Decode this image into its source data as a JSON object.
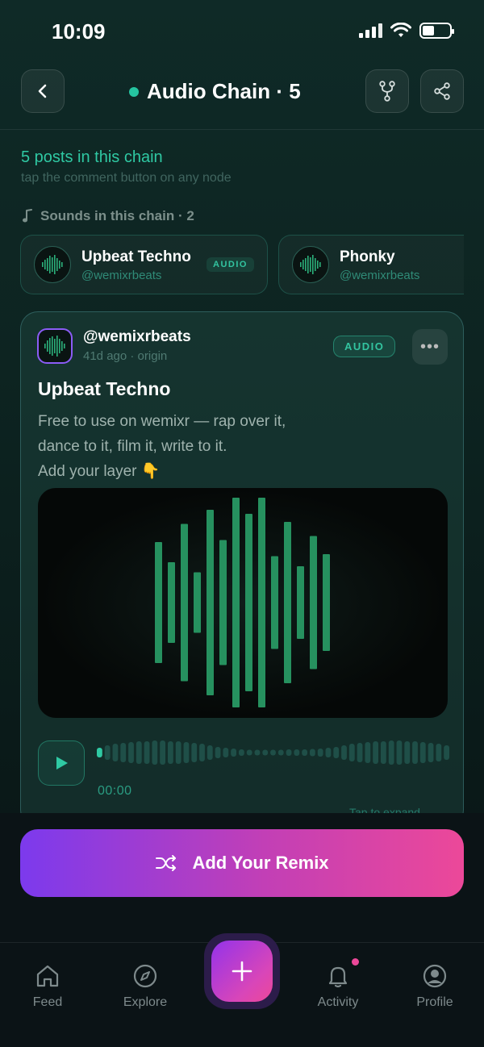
{
  "status_bar": {
    "time": "10:09"
  },
  "header": {
    "title": "Audio Chain · 5",
    "accent": "#25c4a0"
  },
  "chain": {
    "count_text": "5 posts in this chain",
    "hint": "tap the comment button on any node"
  },
  "sounds": {
    "label": "Sounds in this chain · 2",
    "items": [
      {
        "name": "Upbeat Techno",
        "handle": "@wemixrbeats",
        "badge": "AUDIO"
      },
      {
        "name": "Phonky",
        "handle": "@wemixrbeats",
        "badge": ""
      }
    ]
  },
  "post": {
    "user": "@wemixrbeats",
    "meta": "41d ago · origin",
    "badge": "AUDIO",
    "title": "Upbeat Techno",
    "body": "Free to use on wemixr — rap over it,\ndance to it, film it, write to it.\nAdd your layer 👇",
    "player": {
      "time": "00:00",
      "expand": "Tap to expand ⌄"
    }
  },
  "remix_button": {
    "label": "Add Your Remix"
  },
  "nav": {
    "feed": "Feed",
    "explore": "Explore",
    "activity": "Activity",
    "profile": "Profile"
  },
  "colors": {
    "brand_purple": "#7c3aed",
    "brand_pink": "#ec4899",
    "accent_teal": "#2fc9a3"
  },
  "icons": [
    "back-icon",
    "fork-icon",
    "share-icon",
    "music-note-icon",
    "more-icon",
    "play-icon",
    "shuffle-icon",
    "home-icon",
    "compass-icon",
    "plus-icon",
    "bell-icon",
    "user-icon"
  ]
}
